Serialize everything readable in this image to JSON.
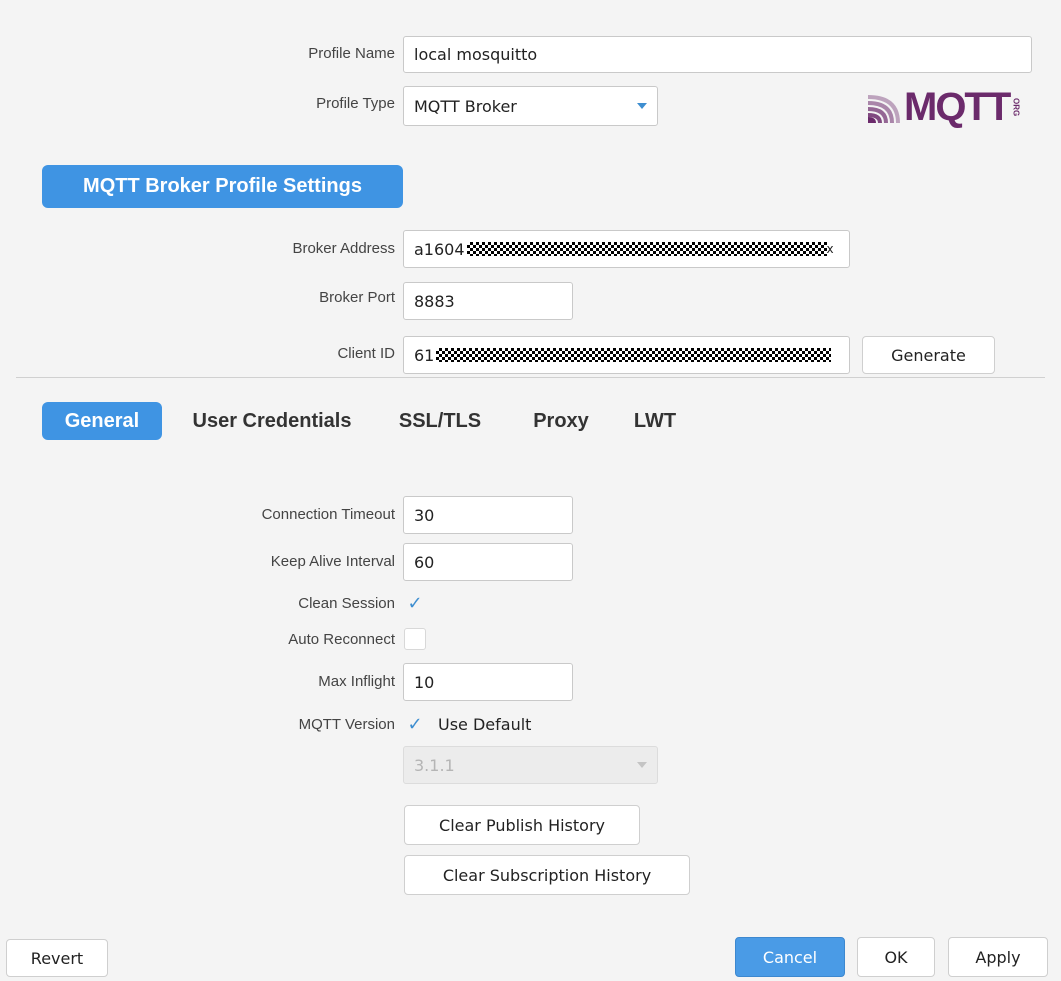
{
  "profile": {
    "name_label": "Profile Name",
    "name_value": "local mosquitto",
    "type_label": "Profile Type",
    "type_value": "MQTT Broker"
  },
  "logo": {
    "text": "MQTT",
    "suffix": "ORG"
  },
  "section_title": "MQTT Broker Profile Settings",
  "broker": {
    "address_label": "Broker Address",
    "address_value": "a1604",
    "address_tail": "x",
    "port_label": "Broker Port",
    "port_value": "8883",
    "client_id_label": "Client ID",
    "client_id_value": "61",
    "generate_label": "Generate"
  },
  "tabs": [
    {
      "label": "General",
      "active": true
    },
    {
      "label": "User Credentials",
      "active": false
    },
    {
      "label": "SSL/TLS",
      "active": false
    },
    {
      "label": "Proxy",
      "active": false
    },
    {
      "label": "LWT",
      "active": false
    }
  ],
  "general": {
    "timeout_label": "Connection Timeout",
    "timeout_value": "30",
    "keepalive_label": "Keep Alive Interval",
    "keepalive_value": "60",
    "clean_session_label": "Clean Session",
    "clean_session_checked": true,
    "auto_reconnect_label": "Auto Reconnect",
    "auto_reconnect_checked": false,
    "max_inflight_label": "Max Inflight",
    "max_inflight_value": "10",
    "mqtt_version_label": "MQTT Version",
    "use_default_label": "Use Default",
    "use_default_checked": true,
    "version_value": "3.1.1",
    "clear_publish_label": "Clear Publish History",
    "clear_subscription_label": "Clear Subscription History"
  },
  "footer": {
    "revert_label": "Revert",
    "cancel_label": "Cancel",
    "ok_label": "OK",
    "apply_label": "Apply"
  },
  "colors": {
    "accent": "#3f94e3",
    "background": "#f4f4f4",
    "logo": "#6b2a6b"
  }
}
